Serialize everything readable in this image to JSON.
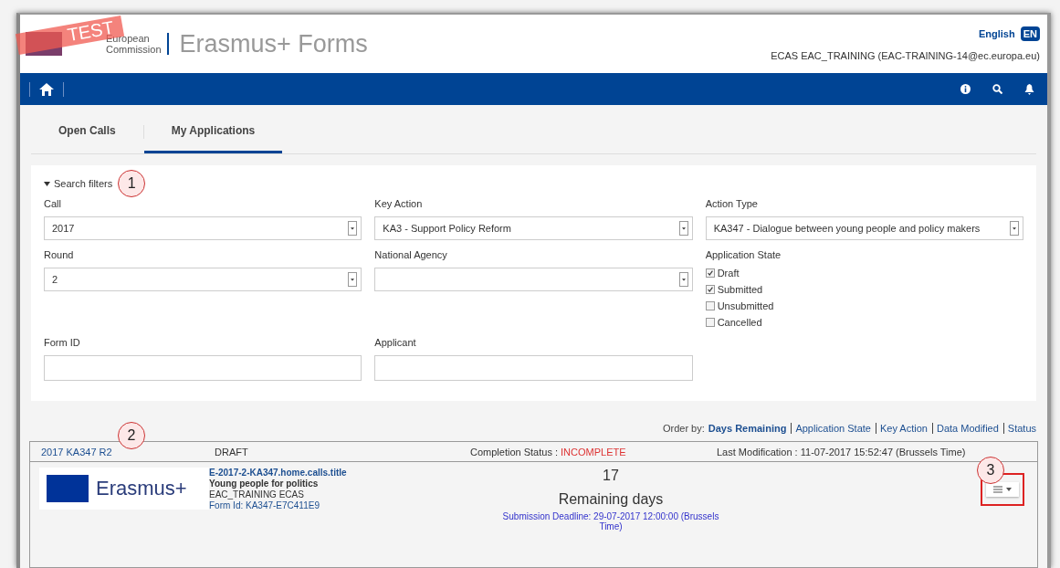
{
  "header": {
    "test_banner": "TEST",
    "logo_line_1": "European",
    "logo_line_2": "Commission",
    "app_title": "Erasmus+ Forms",
    "language": "English",
    "language_code": "EN",
    "user": "ECAS EAC_TRAINING (EAC-TRAINING-14@ec.europa.eu)"
  },
  "tabs": [
    {
      "label": "Open Calls",
      "selected": false
    },
    {
      "label": "My Applications",
      "selected": true
    }
  ],
  "filters": {
    "title": "Search filters",
    "expanded": true,
    "callout": "1",
    "selects": [
      {
        "label": "Call",
        "value": "2017"
      },
      {
        "label": "Key Action",
        "value": "KA3 - Support Policy Reform"
      },
      {
        "label": "Action Type",
        "value": "KA347 - Dialogue between young people and policy makers"
      },
      {
        "label": "Round",
        "value": "2"
      },
      {
        "label": "National Agency"
      }
    ],
    "state_label": "Application State",
    "states": [
      {
        "label": "Draft",
        "checked": true
      },
      {
        "label": "Submitted",
        "checked": true
      },
      {
        "label": "Unsubmitted",
        "checked": false
      },
      {
        "label": "Cancelled",
        "checked": false
      }
    ],
    "inputs": [
      {
        "label": "Form ID"
      },
      {
        "label": "Applicant"
      }
    ]
  },
  "order_by": {
    "label": "Order by:",
    "options": [
      {
        "label": "Days Remaining",
        "selected": true
      },
      {
        "label": "Application State",
        "selected": false
      },
      {
        "label": "Key Action",
        "selected": false
      },
      {
        "label": "Data Modified",
        "selected": false
      },
      {
        "label": "Status",
        "selected": false
      }
    ]
  },
  "application": {
    "code": "2017 KA347 R2",
    "callout": "2",
    "state": "DRAFT",
    "completion_label": "Completion Status :",
    "completion_value": "INCOMPLETE",
    "last_modification": "Last Modification : 11-07-2017 15:52:47 (Brussels Time)",
    "logo_text": "Erasmus+",
    "title": "E-2017-2-KA347.home.calls.title",
    "subtitle": "Young people for politics",
    "owner": "EAC_TRAINING ECAS",
    "form_id": "Form Id: KA347-E7C411E9",
    "days": "17",
    "days_label": "Remaining days",
    "deadline": "Submission Deadline: 29-07-2017 12:00:00 (Brussels Time)",
    "menu_callout": "3"
  }
}
